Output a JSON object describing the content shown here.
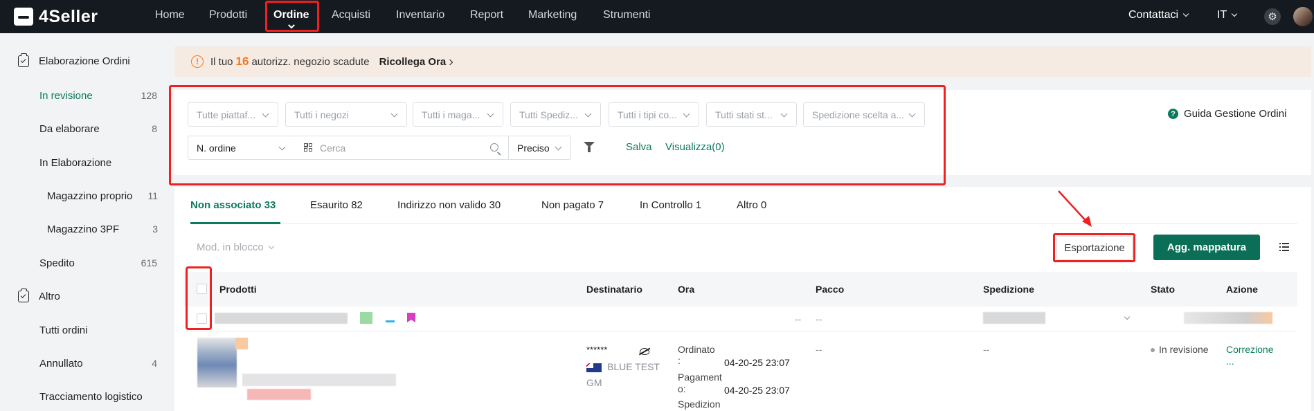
{
  "app": {
    "logo_text": "4Seller"
  },
  "nav": {
    "items": [
      "Home",
      "Prodotti",
      "Ordine",
      "Acquisti",
      "Inventario",
      "Report",
      "Marketing",
      "Strumenti"
    ],
    "contact": "Contattaci",
    "language": "IT"
  },
  "sidebar": {
    "group1": "Elaborazione Ordini",
    "items": [
      {
        "label": "In revisione",
        "count": "128"
      },
      {
        "label": "Da elaborare",
        "count": "8"
      },
      {
        "label": "In Elaborazione",
        "count": ""
      },
      {
        "label": "Magazzino proprio",
        "count": "11"
      },
      {
        "label": "Magazzino 3PF",
        "count": "3"
      },
      {
        "label": "Spedito",
        "count": "615"
      }
    ],
    "group2": "Altro",
    "items2": [
      {
        "label": "Tutti ordini",
        "count": ""
      },
      {
        "label": "Annullato",
        "count": "4"
      },
      {
        "label": "Tracciamento logistico",
        "count": ""
      }
    ]
  },
  "alert": {
    "prefix": "Il tuo",
    "number": "16",
    "suffix": "autorizz. negozio scadute",
    "link": "Ricollega Ora"
  },
  "filters": {
    "dropdowns": [
      "Tutte piattaf...",
      "Tutti i negozi",
      "Tutti i maga...",
      "Tutti Spediz...",
      "Tutti i tipi co...",
      "Tutti stati st...",
      "Spedizione scelta a..."
    ],
    "order_field": "N. ordine",
    "search_placeholder": "Cerca",
    "match": "Preciso",
    "save": "Salva",
    "view": "Visualizza(0)",
    "help": "Guida Gestione Ordini"
  },
  "tabs": [
    "Non associato 33",
    "Esaurito 82",
    "Indirizzo non valido 30",
    "Non pagato 7",
    "In Controllo 1",
    "Altro 0"
  ],
  "toolbar": {
    "bulk": "Mod. in blocco",
    "export": "Esportazione",
    "mapping": "Agg. mappatura"
  },
  "table": {
    "columns": [
      "Prodotti",
      "Destinatario",
      "Ora",
      "Pacco",
      "Spedizione",
      "Stato",
      "Azione"
    ],
    "group_row": {
      "pacco": "--",
      "dash_left": "--"
    },
    "row": {
      "recipient_mask": "******",
      "recipient_name": "BLUE TEST",
      "recipient_country": "GM",
      "ordered_label": "Ordinato",
      "ordered_colon": ":",
      "ordered_time": "04-20-25 23:07",
      "paid_label": "Pagament",
      "paid_label2": "o:",
      "paid_time": "04-20-25 23:07",
      "ship_label": "Spedizion",
      "pacco": "--",
      "spedizione": "--",
      "stato": "In revisione",
      "azione": "Correzione",
      "azione_more": "..."
    }
  },
  "colors": {
    "accent": "#0b7a5d",
    "nav_bg": "#141a1f",
    "highlight": "#ef2020",
    "alert_orange": "#f07a22"
  }
}
